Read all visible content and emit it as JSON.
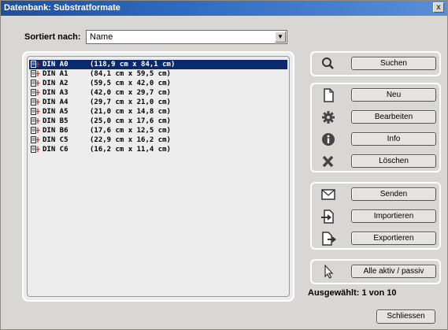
{
  "window": {
    "title": "Datenbank: Substratformate",
    "close_glyph": "x"
  },
  "sort": {
    "label": "Sortiert nach:",
    "value": "Name"
  },
  "list": {
    "items": [
      {
        "name": "DIN A0",
        "size": "(118,9 cm x 84,1 cm)",
        "selected": true
      },
      {
        "name": "DIN A1",
        "size": "(84,1 cm x 59,5 cm)",
        "selected": false
      },
      {
        "name": "DIN A2",
        "size": "(59,5 cm x 42,0 cm)",
        "selected": false
      },
      {
        "name": "DIN A3",
        "size": "(42,0 cm x 29,7 cm)",
        "selected": false
      },
      {
        "name": "DIN A4",
        "size": "(29,7 cm x 21,0 cm)",
        "selected": false
      },
      {
        "name": "DIN A5",
        "size": "(21,0 cm x 14,8 cm)",
        "selected": false
      },
      {
        "name": "DIN B5",
        "size": "(25,0 cm x 17,6 cm)",
        "selected": false
      },
      {
        "name": "DIN B6",
        "size": "(17,6 cm x 12,5 cm)",
        "selected": false
      },
      {
        "name": "DIN C5",
        "size": "(22,9 cm x 16,2 cm)",
        "selected": false
      },
      {
        "name": "DIN C6",
        "size": "(16,2 cm x 11,4 cm)",
        "selected": false
      }
    ]
  },
  "buttons": {
    "search": "Suchen",
    "new": "Neu",
    "edit": "Bearbeiten",
    "info": "Info",
    "delete": "Löschen",
    "send": "Senden",
    "import": "Importieren",
    "export": "Exportieren",
    "toggle_active": "Alle aktiv / passiv",
    "close": "Schliessen"
  },
  "status": {
    "selection": "Ausgewählt: 1 von 10"
  },
  "colors": {
    "titlebar": "#2f6ac0",
    "selection": "#0b2a6b",
    "dialog_bg": "#d8d7d3"
  }
}
